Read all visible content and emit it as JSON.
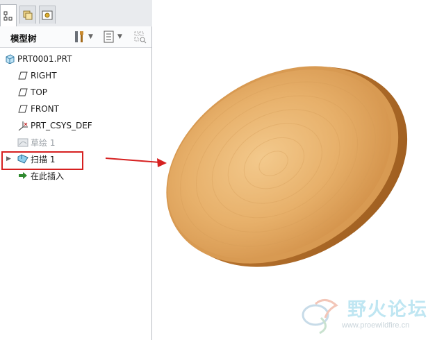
{
  "panel": {
    "title": "模型树",
    "tabs": [
      {
        "icon": "model-tree-icon",
        "active": true
      },
      {
        "icon": "folder-browser-icon",
        "active": false
      },
      {
        "icon": "favorites-icon",
        "active": false
      }
    ],
    "tools": [
      "settings-tools-icon",
      "show-list-icon",
      "filter-icon"
    ]
  },
  "tree": {
    "root": "PRT0001.PRT",
    "items": [
      {
        "label": "RIGHT",
        "icon": "datum-plane-icon",
        "state": "normal"
      },
      {
        "label": "TOP",
        "icon": "datum-plane-icon",
        "state": "normal"
      },
      {
        "label": "FRONT",
        "icon": "datum-plane-icon",
        "state": "normal"
      },
      {
        "label": "PRT_CSYS_DEF",
        "icon": "coordinate-system-icon",
        "state": "normal"
      },
      {
        "label": "草绘 1",
        "icon": "sketch-icon",
        "state": "suppressed"
      },
      {
        "label": "扫描 1",
        "icon": "sweep-feature-icon",
        "state": "highlighted"
      },
      {
        "label": "在此插入",
        "icon": "insert-arrow-icon",
        "state": "normal"
      }
    ]
  },
  "colors": {
    "highlight": "#d62020",
    "arrow": "#d62020",
    "part_base": "#e0a45a",
    "watermark": "#bfe6f2"
  },
  "watermark": {
    "title": "野火论坛",
    "url": "www.proewildfire.cn"
  }
}
